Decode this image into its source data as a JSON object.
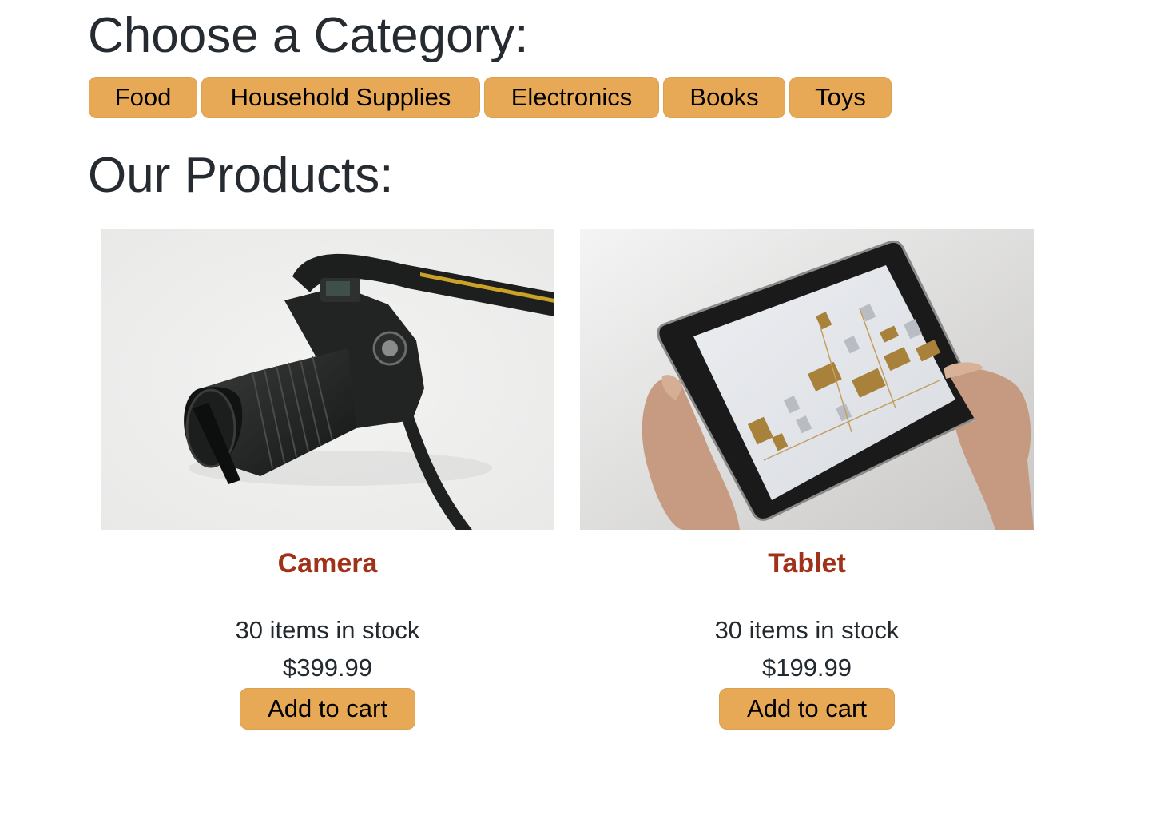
{
  "headings": {
    "categories": "Choose a Category:",
    "products": "Our Products:"
  },
  "categories": [
    {
      "label": "Food"
    },
    {
      "label": "Household Supplies"
    },
    {
      "label": "Electronics"
    },
    {
      "label": "Books"
    },
    {
      "label": "Toys"
    }
  ],
  "products": [
    {
      "name": "Camera",
      "image": "camera-photo",
      "stock": "30 items in stock",
      "price": "$399.99",
      "button": "Add to cart"
    },
    {
      "name": "Tablet",
      "image": "tablet-photo",
      "stock": "30 items in stock",
      "price": "$199.99",
      "button": "Add to cart"
    }
  ],
  "colors": {
    "button": "#e8a957",
    "product_name": "#a1321a",
    "heading": "#252b30"
  }
}
